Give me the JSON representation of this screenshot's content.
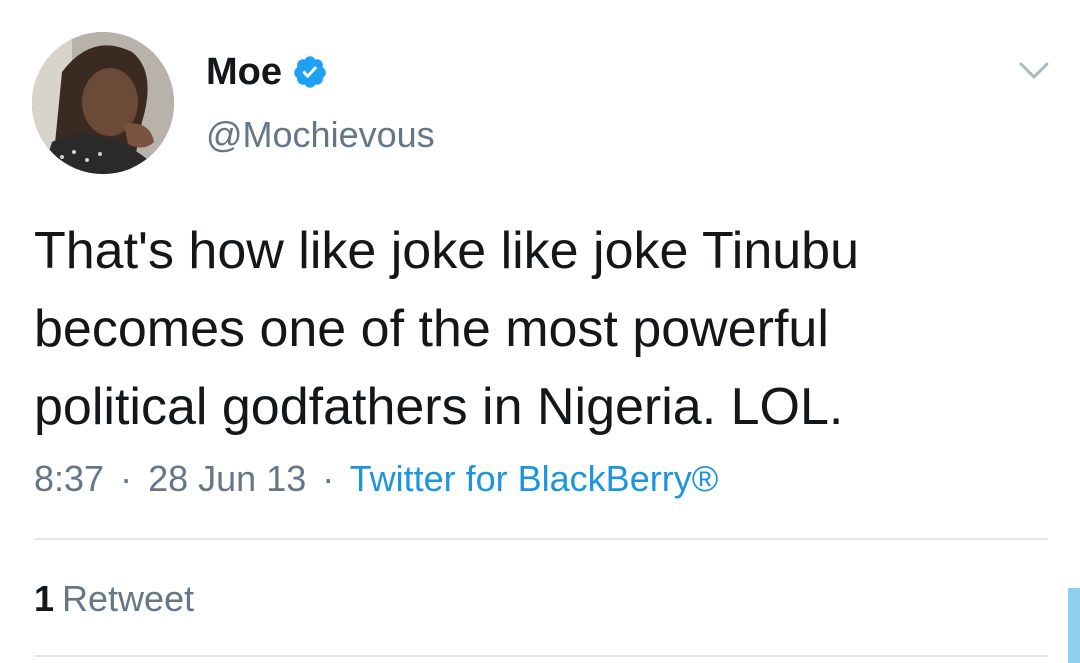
{
  "tweet": {
    "author": {
      "display_name": "Moe",
      "handle": "@Mochievous",
      "verified": true
    },
    "text_lines": [
      "That's how like joke like joke Tinubu",
      "becomes one of the most powerful",
      "political godfathers in Nigeria. LOL."
    ],
    "meta": {
      "time": "8:37",
      "separator": "·",
      "date": "28 Jun 13",
      "source": "Twitter for BlackBerry®"
    },
    "stats": {
      "retweet_count": "1",
      "retweet_label": "Retweet"
    }
  },
  "icons": {
    "verified": "verified-badge-icon",
    "menu": "chevron-down-icon"
  },
  "colors": {
    "text_primary": "#14171a",
    "text_secondary": "#657786",
    "link": "#1b95e0",
    "verified": "#1da1f2",
    "divider": "#e1e8ed"
  }
}
